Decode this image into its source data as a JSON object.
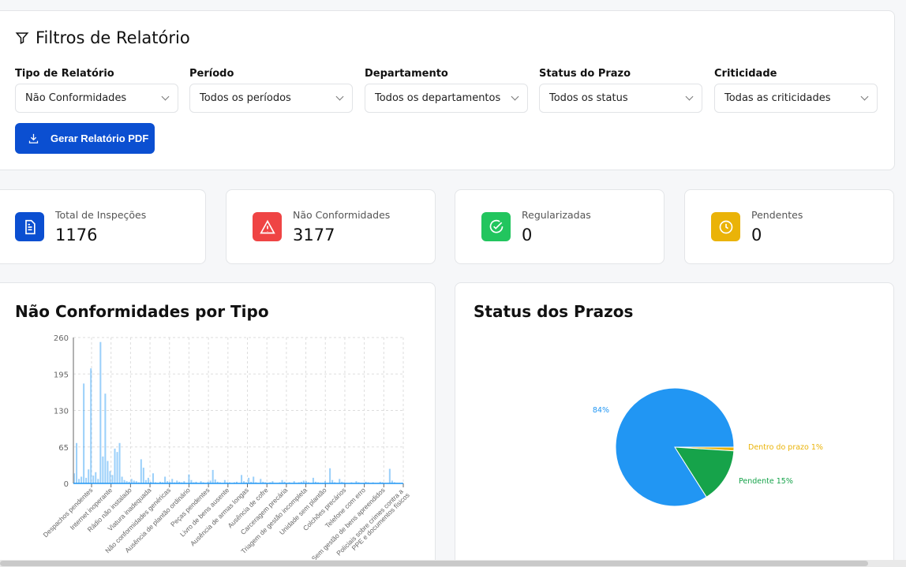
{
  "filters": {
    "title": "Filtros de Relatório",
    "fields": [
      {
        "label": "Tipo de Relatório",
        "value": "Não Conformidades"
      },
      {
        "label": "Período",
        "value": "Todos os períodos"
      },
      {
        "label": "Departamento",
        "value": "Todos os departamentos"
      },
      {
        "label": "Status do Prazo",
        "value": "Todos os status"
      },
      {
        "label": "Criticidade",
        "value": "Todas as criticidades"
      }
    ],
    "pdf_button": "Gerar Relatório PDF"
  },
  "stats": [
    {
      "label": "Total de Inspeções",
      "value": "1176",
      "color": "#0b4fd1",
      "icon": "document-icon"
    },
    {
      "label": "Não Conformidades",
      "value": "3177",
      "color": "#ef4444",
      "icon": "warning-icon"
    },
    {
      "label": "Regularizadas",
      "value": "0",
      "color": "#22c55e",
      "icon": "check-circle-icon"
    },
    {
      "label": "Pendentes",
      "value": "0",
      "color": "#eab308",
      "icon": "clock-icon"
    }
  ],
  "bar_title": "Não Conformidades por Tipo",
  "pie_title": "Status dos Prazos",
  "chart_data": [
    {
      "type": "bar",
      "title": "Não Conformidades por Tipo",
      "ylim": [
        0,
        260
      ],
      "yticks": [
        0,
        65,
        130,
        195,
        260
      ],
      "color": "#2196f3",
      "tick_labels": [
        "Despachos pendentes",
        "Internet inoperante",
        "Rádio não instalado",
        "Viatura inadequada",
        "Não conformidades genéricas",
        "Ausência de plantão ordinário",
        "Peças pendentes",
        "Livro de bens ausente",
        "Ausência de armas longas",
        "Ausência de cofre",
        "Carceragem precária",
        "Triagem de gestão incompleta",
        "Unidade sem plantão",
        "Colchões precários",
        "Telefone com erro",
        "Sem gestão de bens apreendidos",
        "Policiais sobre crimes contra a PPE e documentos físicos"
      ],
      "values": [
        18,
        72,
        8,
        12,
        178,
        10,
        25,
        205,
        14,
        20,
        8,
        252,
        48,
        160,
        40,
        22,
        15,
        62,
        56,
        72,
        12,
        6,
        4,
        3,
        8,
        5,
        4,
        2,
        43,
        28,
        6,
        10,
        3,
        18,
        2,
        1,
        3,
        2,
        12,
        4,
        3,
        8,
        2,
        5,
        3,
        2,
        4,
        1,
        16,
        6,
        2,
        3,
        1,
        4,
        2,
        1,
        3,
        5,
        24,
        7,
        3,
        2,
        1,
        6,
        2,
        2,
        1,
        2,
        3,
        1,
        15,
        4,
        2,
        10,
        3,
        12,
        2,
        1,
        8,
        3,
        2,
        1,
        2,
        4,
        1,
        1,
        2,
        6,
        3,
        1,
        2,
        1,
        4,
        1,
        2,
        3,
        5,
        4,
        2,
        1,
        10,
        3,
        2,
        1,
        1,
        4,
        1,
        27,
        6,
        2,
        1,
        8,
        3,
        2,
        1,
        1,
        2,
        1,
        4,
        2,
        1,
        1,
        3,
        2,
        1,
        2,
        1,
        1,
        3,
        2,
        1,
        1,
        26,
        5,
        2,
        1,
        1,
        1
      ],
      "grid": true
    },
    {
      "type": "pie",
      "title": "Status dos Prazos",
      "slices": [
        {
          "label": "",
          "percent": 84,
          "color": "#2196f3"
        },
        {
          "label": "Pendente",
          "percent": 15,
          "color": "#16a34a"
        },
        {
          "label": "Dentro do prazo",
          "percent": 1,
          "color": "#eab308"
        }
      ],
      "display_labels": [
        "84%",
        "Pendente 15%",
        "Dentro do prazo 1%"
      ]
    }
  ]
}
